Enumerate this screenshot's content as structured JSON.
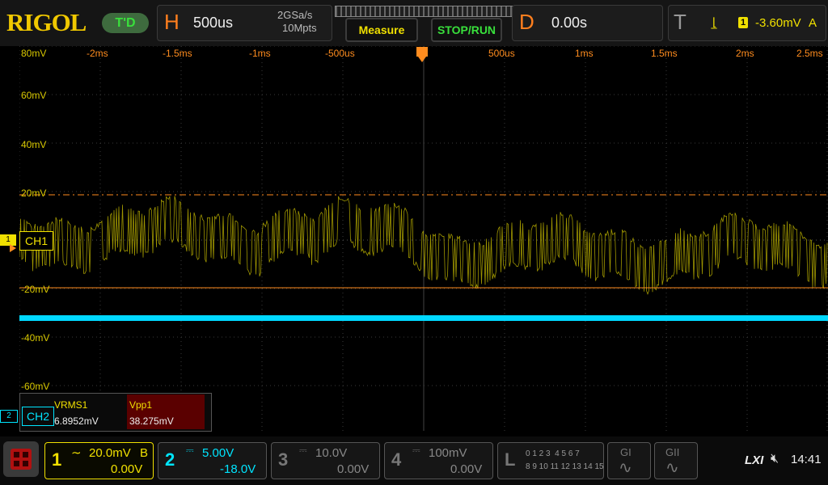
{
  "brand": {
    "logo": "RIGOL",
    "mode": "T'D"
  },
  "horizontal": {
    "letter": "H",
    "timebase": "500us",
    "rate": "2GSa/s",
    "depth": "10Mpts"
  },
  "buttons": {
    "measure": "Measure",
    "stoprun": "STOP/RUN"
  },
  "delay": {
    "letter": "D",
    "value": "0.00s"
  },
  "trigger": {
    "letter": "T",
    "channel": "1",
    "level": "-3.60mV",
    "mode": "A"
  },
  "x_ticks": [
    "-2ms",
    "-1.5ms",
    "-1ms",
    "-500us",
    "500us",
    "1ms",
    "1.5ms",
    "2ms",
    "2.5ms"
  ],
  "y_ticks": [
    "80mV",
    "60mV",
    "40mV",
    "20mV",
    "-20mV",
    "-40mV",
    "-60mV"
  ],
  "markers": {
    "ch1": "CH1",
    "ch1_num": "1",
    "ch2": "CH2",
    "ch2_num": "2"
  },
  "measurements": {
    "vrms_label": "VRMS1",
    "vrms_value": "6.8952mV",
    "vpp_label": "Vpp1",
    "vpp_value": "38.275mV"
  },
  "channels": [
    {
      "num": "1",
      "scale": "20.0mV",
      "bw": "B",
      "offset": "0.00V",
      "color": "#f0e000"
    },
    {
      "num": "2",
      "scale": "5.00V",
      "offset": "-18.0V",
      "color": "#00e5ff"
    },
    {
      "num": "3",
      "scale": "10.0V",
      "offset": "0.00V",
      "color": "#777777"
    },
    {
      "num": "4",
      "scale": "100mV",
      "offset": "0.00V",
      "color": "#777777"
    }
  ],
  "logic": {
    "letter": "L",
    "row1": "0 1 2 3  4 5 6 7",
    "row2": "8 9 10 11 12 13 14 15"
  },
  "gen": {
    "g1": "GI",
    "g2": "GII"
  },
  "status": {
    "lxi": "LXI",
    "time": "14:41"
  },
  "icons": [
    "menu-icon",
    "speaker-muted-icon",
    "sine-icon"
  ]
}
